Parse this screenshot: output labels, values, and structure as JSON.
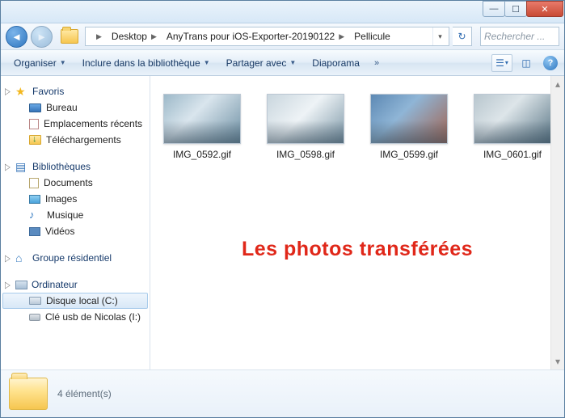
{
  "breadcrumbs": [
    {
      "label": "Desktop"
    },
    {
      "label": "AnyTrans pour iOS-Exporter-20190122"
    },
    {
      "label": "Pellicule"
    }
  ],
  "search": {
    "placeholder": "Rechercher ..."
  },
  "toolbar": {
    "organize": "Organiser",
    "include": "Inclure dans la bibliothèque",
    "share": "Partager avec",
    "slideshow": "Diaporama"
  },
  "sidebar": {
    "favorites": {
      "title": "Favoris",
      "items": [
        "Bureau",
        "Emplacements récents",
        "Téléchargements"
      ]
    },
    "libraries": {
      "title": "Bibliothèques",
      "items": [
        "Documents",
        "Images",
        "Musique",
        "Vidéos"
      ]
    },
    "homegroup": {
      "title": "Groupe résidentiel"
    },
    "computer": {
      "title": "Ordinateur",
      "items": [
        "Disque local (C:)",
        "Clé usb de Nicolas (I:)"
      ]
    }
  },
  "files": [
    {
      "name": "IMG_0592.gif"
    },
    {
      "name": "IMG_0598.gif"
    },
    {
      "name": "IMG_0599.gif"
    },
    {
      "name": "IMG_0601.gif"
    }
  ],
  "overlay_text": "Les photos transférées",
  "status": {
    "count_text": "4 élément(s)"
  }
}
